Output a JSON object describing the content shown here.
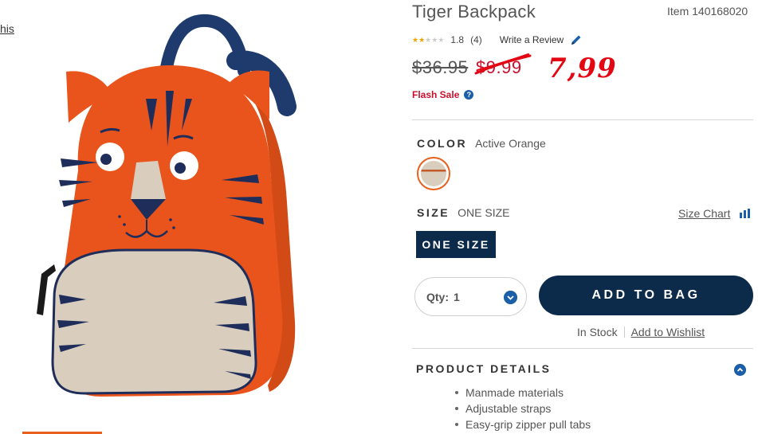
{
  "left_panel": {
    "link_text": "his"
  },
  "product": {
    "title": "Tiger Backpack",
    "item_number": "Item 140168020",
    "rating": {
      "value": "1.8",
      "count": "(4)",
      "stars_filled": 1.8,
      "stars_max": 5
    },
    "write_review_label": "Write a Review",
    "original_price": "$36.95",
    "sale_price": "$9.99",
    "handwritten_price": "7,99",
    "flash_sale_label": "Flash Sale",
    "color": {
      "label": "COLOR",
      "value": "Active Orange"
    },
    "size": {
      "label": "SIZE",
      "value": "ONE SIZE",
      "chart_label": "Size Chart",
      "button_label": "ONE SIZE"
    },
    "quantity": {
      "label": "Qty:",
      "value": "1"
    },
    "add_to_bag_label": "ADD TO BAG",
    "stock_status": "In Stock",
    "wishlist_label": "Add to Wishlist",
    "details": {
      "heading": "PRODUCT DETAILS",
      "items": [
        "Manmade materials",
        "Adjustable straps",
        "Easy-grip zipper pull tabs"
      ]
    }
  },
  "colors": {
    "navy": "#0c2b4b",
    "sale_red": "#c8102e",
    "accent_blue": "#1b5fa8",
    "backpack_orange": "#e8541c"
  }
}
